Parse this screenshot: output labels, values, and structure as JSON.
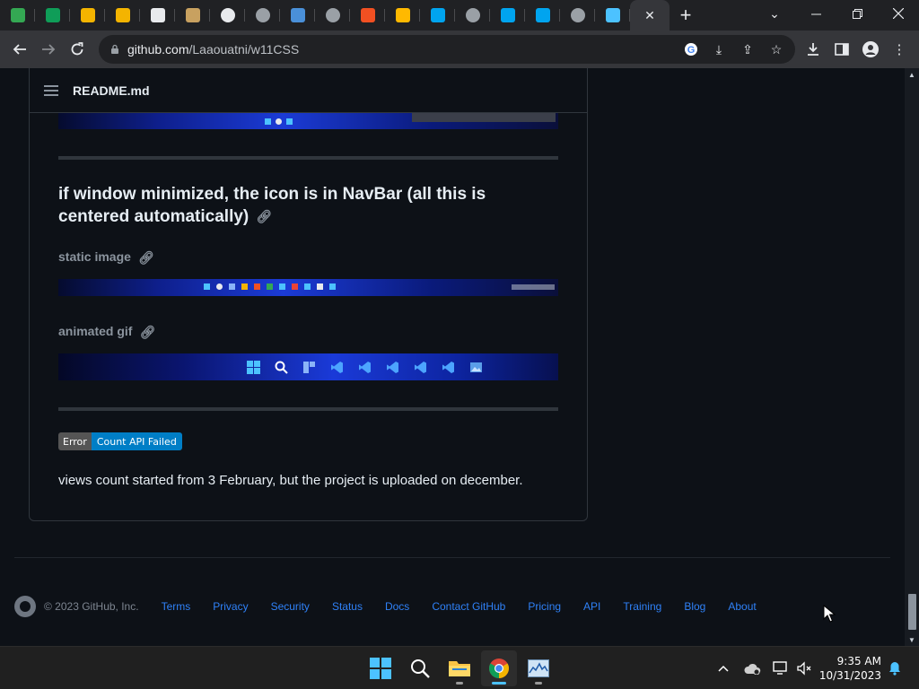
{
  "browser": {
    "tabs": [
      {
        "icon": "app-favicon-icon",
        "color": "#34a853"
      },
      {
        "icon": "sheet-favicon-icon",
        "color": "#0f9d58"
      },
      {
        "icon": "bee-favicon-icon",
        "color": "#f4b400"
      },
      {
        "icon": "bee-favicon-icon",
        "color": "#f4b400"
      },
      {
        "icon": "mask-favicon-icon",
        "color": "#e8eaed"
      },
      {
        "icon": "doge-favicon-icon",
        "color": "#c8a160"
      },
      {
        "icon": "github-favicon-icon",
        "color": "#e8eaed"
      },
      {
        "icon": "globe-favicon-icon",
        "color": "#9aa0a6"
      },
      {
        "icon": "windows-old-favicon-icon",
        "color": "#4a90d9"
      },
      {
        "icon": "globe-favicon-icon",
        "color": "#9aa0a6"
      },
      {
        "icon": "windows-xp-favicon-icon",
        "color": "#f25022"
      },
      {
        "icon": "windows-xp-favicon-icon",
        "color": "#ffb900"
      },
      {
        "icon": "windows-11-favicon-icon",
        "color": "#00a4ef"
      },
      {
        "icon": "globe-favicon-icon",
        "color": "#9aa0a6"
      },
      {
        "icon": "windows-11-favicon-icon",
        "color": "#00a4ef"
      },
      {
        "icon": "windows-11-favicon-icon",
        "color": "#00a4ef"
      },
      {
        "icon": "globe-favicon-icon",
        "color": "#9aa0a6"
      },
      {
        "icon": "settings-favicon-icon",
        "color": "#4cc2ff"
      }
    ],
    "active_tab_close": "✕",
    "new_tab": "+",
    "url_host": "github.com",
    "url_path": "/Laaouatni/w11CSS"
  },
  "readme": {
    "file_name": "README.md",
    "heading": "if window minimized, the icon is in NavBar (all this is centered automatically)",
    "static_label": "static image",
    "animated_label": "animated gif",
    "badge_left": "Error",
    "badge_right": "Count API Failed",
    "paragraph": "views count started from 3 February, but the project is uploaded on december."
  },
  "footer": {
    "copyright": "© 2023 GitHub, Inc.",
    "links": [
      "Terms",
      "Privacy",
      "Security",
      "Status",
      "Docs",
      "Contact GitHub",
      "Pricing",
      "API",
      "Training",
      "Blog",
      "About"
    ]
  },
  "system": {
    "time": "9:35 AM",
    "date": "10/31/2023"
  },
  "colors": {
    "page_bg": "#0d1117",
    "link": "#2f81f7",
    "border": "#30363d",
    "badge_blue": "#007ec6"
  }
}
